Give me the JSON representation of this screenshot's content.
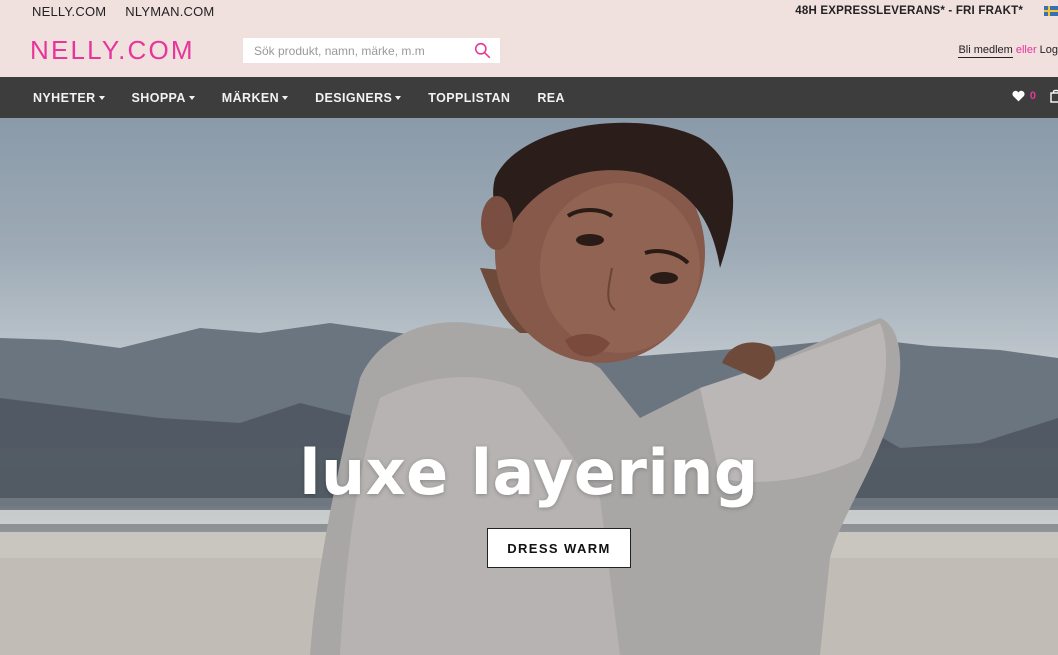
{
  "header": {
    "sites": [
      "NELLY.COM",
      "NLYMAN.COM"
    ],
    "promo": "48H EXPRESSLEVERANS* - FRI FRAKT*",
    "logo": "NELLY.COM",
    "search_placeholder": "Sök produkt, namn, märke, m.m",
    "account": {
      "join": "Bli medlem",
      "or": "eller",
      "login": "Log"
    }
  },
  "nav": {
    "items": [
      {
        "label": "NYHETER",
        "dropdown": true
      },
      {
        "label": "SHOPPA",
        "dropdown": true
      },
      {
        "label": "MÄRKEN",
        "dropdown": true
      },
      {
        "label": "DESIGNERS",
        "dropdown": true
      },
      {
        "label": "TOPPLISTAN",
        "dropdown": false
      },
      {
        "label": "REA",
        "dropdown": false
      }
    ],
    "wishlist_count": "0"
  },
  "hero": {
    "headline": "luxe layering",
    "cta": "DRESS WARM"
  },
  "icons": {
    "search": "search-icon",
    "wishlist": "heart-icon",
    "bag": "shopping-bag-icon",
    "flag": "sweden-flag-icon"
  },
  "colors": {
    "brand_pink": "#e8359b",
    "header_bg": "#f0e0de",
    "nav_bg": "#3d3d3d"
  }
}
